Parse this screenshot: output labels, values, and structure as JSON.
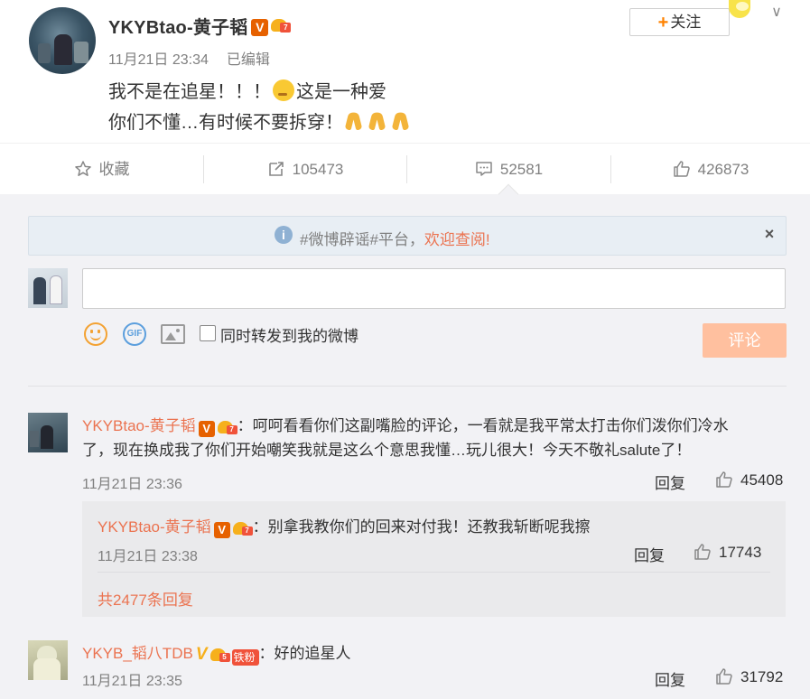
{
  "post": {
    "author": "YKYBtao-黄子韬",
    "verified_badge": "V",
    "crown_level": "7",
    "time": "11月21日 23:34",
    "edited": "已编辑",
    "text_line1_a": "我不是在追星！！！",
    "text_line1_b": "这是一种爱",
    "text_line2": "你们不懂…有时候不要拆穿！",
    "follow_label": "关注",
    "follow_plus": "+",
    "menu_chevron": "∨"
  },
  "actions": {
    "favorite": "收藏",
    "repost": "105473",
    "comment": "52581",
    "like": "426873"
  },
  "notice": {
    "text": "#微博辟谣#平台，",
    "link": "欢迎查阅!",
    "info": "i",
    "close": "×"
  },
  "composer": {
    "input_value": "",
    "gif": "GIF",
    "repost_checkbox_label": "同时转发到我的微博",
    "submit_label": "评论"
  },
  "comments": [
    {
      "author": "YKYBtao-黄子韬",
      "badge": "V",
      "crown": "7",
      "line1": "：呵呵看看你们这副嘴脸的评论，一看就是我平常太打击你们泼你们冷水",
      "line2": "了，现在换成我了你们开始嘲笑我就是这么个意思我懂…玩儿很大！今天不敬礼salute了！",
      "time": "11月21日 23:36",
      "reply": "回复",
      "likes": "45408"
    },
    {
      "author": "YKYB_韬八TDB",
      "badge": "V",
      "crown": "5",
      "fan_badge": "铁粉",
      "text": "：好的追星人",
      "time": "11月21日 23:35",
      "reply": "回复",
      "likes": "31792"
    }
  ],
  "sub_comment": {
    "author": "YKYBtao-黄子韬",
    "badge": "V",
    "crown": "7",
    "text": "：别拿我教你们的回来对付我！还教我斩断呢我擦",
    "time": "11月21日 23:38",
    "reply": "回复",
    "likes": "17743",
    "more_replies": "共2477条回复"
  },
  "colors": {
    "accent": "#eb7350",
    "follow_plus": "#ff8200",
    "verified": "#e66100",
    "submit_disabled": "#ffc09f",
    "panel_bg": "#f2f2f5"
  }
}
